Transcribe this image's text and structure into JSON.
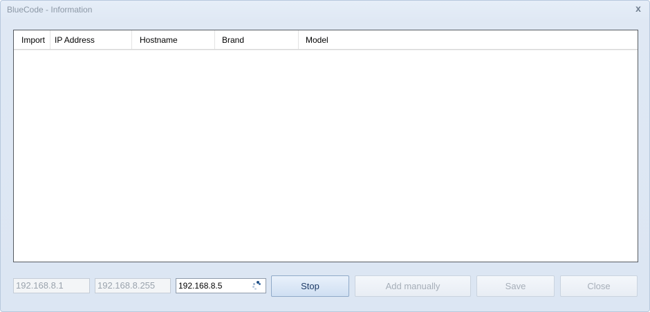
{
  "window": {
    "title": "BlueCode - Information",
    "close_glyph": "x"
  },
  "table": {
    "columns": [
      "Import",
      "IP Address",
      "Hostname",
      "Brand",
      "Model"
    ],
    "rows": []
  },
  "range": {
    "from_value": "192.168.8.1",
    "to_value": "192.168.8.255",
    "current_value": "192.168.8.5",
    "spinner_icon": "busy-spinner-icon"
  },
  "buttons": {
    "stop": "Stop",
    "add_manually": "Add manually",
    "save": "Save",
    "close": "Close"
  },
  "colors": {
    "window_bg": "#dfe8f4",
    "title_text": "#8b97a5",
    "disabled_text": "#a6aeb8",
    "stop_button_bg": "#cfdff2"
  }
}
